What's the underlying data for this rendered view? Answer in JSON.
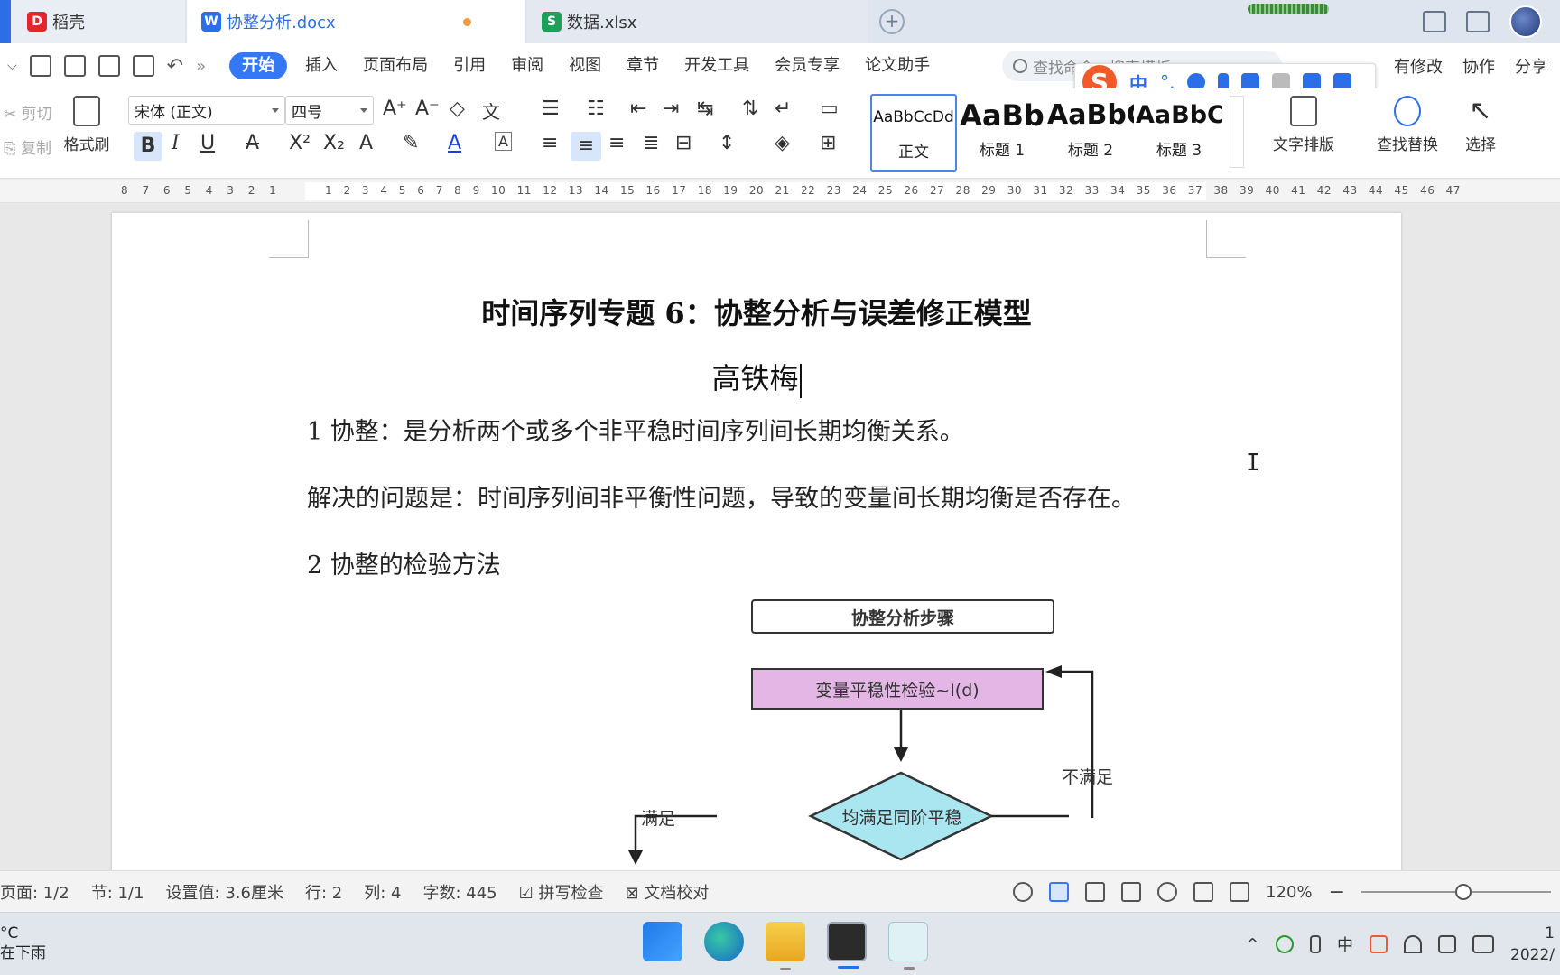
{
  "tabs": [
    {
      "label": "稻壳",
      "icon": "daoke-icon",
      "color": "#e3262c"
    },
    {
      "label": "协整分析.docx",
      "icon": "wps-writer-icon",
      "color": "#2c6ee6"
    },
    {
      "label": "数据.xlsx",
      "icon": "wps-sheet-icon",
      "color": "#1ea05a"
    }
  ],
  "menu": {
    "items": [
      "开始",
      "插入",
      "页面布局",
      "引用",
      "审阅",
      "视图",
      "章节",
      "开发工具",
      "会员专享",
      "论文助手"
    ],
    "active": "开始",
    "search_placeholder": "查找命令、搜索模板",
    "right": [
      "有修改",
      "协作",
      "分享"
    ]
  },
  "ribbon": {
    "cut": "剪切",
    "copy": "复制",
    "format_painter": "格式刷",
    "font_name": "宋体 (正文)",
    "font_size": "四号",
    "styles": [
      {
        "preview": "AaBbCcDd",
        "label": "正文"
      },
      {
        "preview": "AaBb",
        "label": "标题 1"
      },
      {
        "preview": "AaBbC",
        "label": "标题 2"
      },
      {
        "preview": "AaBbC",
        "label": "标题 3"
      }
    ],
    "text_layout": "文字排版",
    "find_replace": "查找替换",
    "select": "选择"
  },
  "ruler": {
    "left_numbers": "8  7  6  5  4  3  2  1",
    "right_numbers": "1  2  3  4  5  6  7  8  9  10 11 12 13 14 15 16 17 18 19 20 21 22 23 24 25 26 27 28 29 30 31 32 33 34 35 36 37 38 39 40 41 42 43 44 45 46 47"
  },
  "document": {
    "title": "时间序列专题 6：协整分析与误差修正模型",
    "author": "高铁梅",
    "para1": "1 协整：是分析两个或多个非平稳时间序列间长期均衡关系。",
    "para2": "解决的问题是：时间序列间非平衡性问题，导致的变量间长期均衡是否存在。",
    "para3": "2 协整的检验方法",
    "flowchart": {
      "header": "协整分析步骤",
      "step1": "变量平稳性检验~I(d)",
      "decision": "均满足同阶平稳",
      "yes": "满足",
      "no": "不满足",
      "step1_color": "#e4b6e6",
      "decision_color": "#a9e6ef"
    }
  },
  "status": {
    "page": "页面: 1/2",
    "section": "节: 1/1",
    "setting": "设置值: 3.6厘米",
    "row": "行: 2",
    "col": "列: 4",
    "words": "字数: 445",
    "spell": "拼写检查",
    "proof": "文档校对",
    "zoom": "120%"
  },
  "taskbar": {
    "weather_temp": "°C",
    "weather_desc": "在下雨",
    "ime": "中",
    "clock_line1": "1",
    "clock_line2": "2022/"
  }
}
